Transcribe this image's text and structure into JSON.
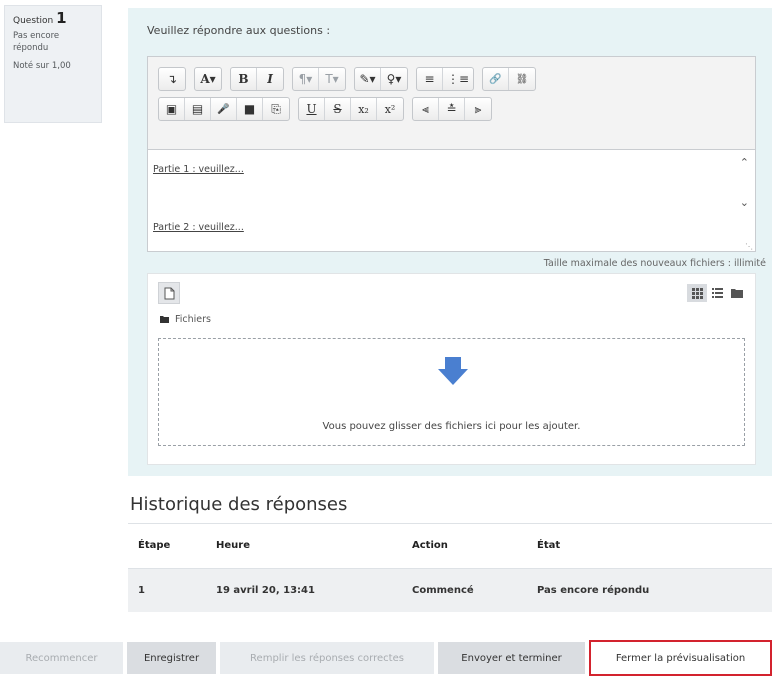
{
  "question_info": {
    "label": "Question",
    "number": "1",
    "status": "Pas encore répondu",
    "grade": "Noté sur 1,00"
  },
  "prompt": "Veuillez répondre aux questions :",
  "editor": {
    "line1": "Partie 1 : veuillez...",
    "line2": "Partie 2 : veuillez...",
    "toolbar_row1": [
      {
        "icon": "collapse-icon",
        "glyph": "↴"
      },
      {
        "icon": "style-icon",
        "glyph": "A▾"
      },
      {
        "icon": "bold-icon",
        "glyph": "B"
      },
      {
        "icon": "italic-icon",
        "glyph": "I"
      },
      {
        "icon": "direction-icon",
        "glyph": "¶▾"
      },
      {
        "icon": "font-size-icon",
        "glyph": "T▾"
      },
      {
        "icon": "text-color-icon",
        "glyph": "✎▾"
      },
      {
        "icon": "bg-color-icon",
        "glyph": "♀▾"
      },
      {
        "icon": "unordered-list-icon",
        "glyph": "≡"
      },
      {
        "icon": "ordered-list-icon",
        "glyph": "⋮≡"
      },
      {
        "icon": "link-icon",
        "glyph": "🔗"
      },
      {
        "icon": "unlink-icon",
        "glyph": "⛓"
      }
    ],
    "toolbar_row2": [
      {
        "icon": "image-icon",
        "glyph": "▣"
      },
      {
        "icon": "media-icon",
        "glyph": "▤"
      },
      {
        "icon": "record-audio-icon",
        "glyph": "🎤"
      },
      {
        "icon": "record-video-icon",
        "glyph": "■"
      },
      {
        "icon": "manage-files-icon",
        "glyph": "⎘"
      },
      {
        "icon": "underline-icon",
        "glyph": "U"
      },
      {
        "icon": "strikethrough-icon",
        "glyph": "S"
      },
      {
        "icon": "subscript-icon",
        "glyph": "x₂"
      },
      {
        "icon": "superscript-icon",
        "glyph": "x²"
      },
      {
        "icon": "align-left-icon",
        "glyph": "⫷"
      },
      {
        "icon": "align-center-icon",
        "glyph": "≛"
      },
      {
        "icon": "align-right-icon",
        "glyph": "⫸"
      }
    ]
  },
  "max_size": "Taille maximale des nouveaux fichiers : illimité",
  "filepicker": {
    "path_label": "Fichiers",
    "drop_text": "Vous pouvez glisser des fichiers ici pour les ajouter."
  },
  "history": {
    "title": "Historique des réponses",
    "columns": [
      "Étape",
      "Heure",
      "Action",
      "État"
    ],
    "rows": [
      [
        "1",
        "19 avril 20, 13:41",
        "Commencé",
        "Pas encore répondu"
      ]
    ]
  },
  "buttons": {
    "restart": "Recommencer",
    "save": "Enregistrer",
    "fill_correct": "Remplir les réponses correctes",
    "submit": "Envoyer et terminer",
    "close_preview": "Fermer la prévisualisation"
  },
  "colors": {
    "content_bg": "#e7f3f5",
    "accent_arrow": "#4a7fd0",
    "highlight_border": "#d3232e"
  }
}
